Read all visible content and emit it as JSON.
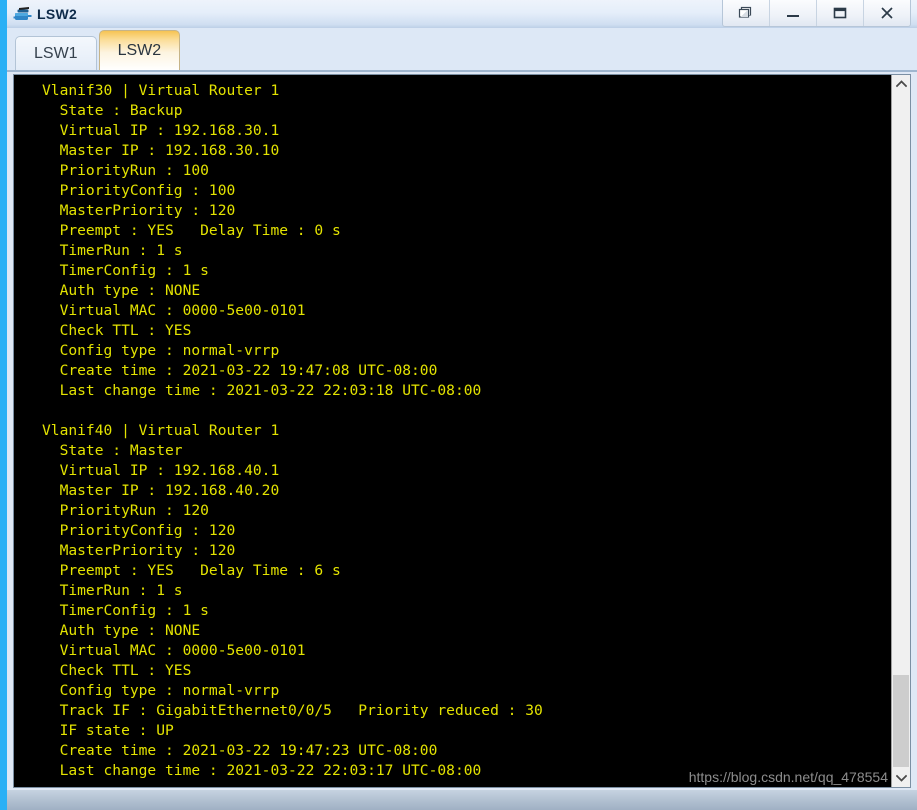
{
  "window": {
    "title": "LSW2",
    "icon": "switch-icon",
    "controls": [
      {
        "name": "restore-down-button",
        "glyph": "restore"
      },
      {
        "name": "minimize-button",
        "glyph": "minimize"
      },
      {
        "name": "maximize-button",
        "glyph": "maximize"
      },
      {
        "name": "close-button",
        "glyph": "close"
      }
    ],
    "frame_color": "#2ab0f5"
  },
  "tabs": [
    {
      "label": "LSW1",
      "active": false
    },
    {
      "label": "LSW2",
      "active": true
    }
  ],
  "terminal": {
    "background": "#000000",
    "foreground": "#e3e300",
    "content": "Vlanif30 | Virtual Router 1\n  State : Backup\n  Virtual IP : 192.168.30.1\n  Master IP : 192.168.30.10\n  PriorityRun : 100\n  PriorityConfig : 100\n  MasterPriority : 120\n  Preempt : YES   Delay Time : 0 s\n  TimerRun : 1 s\n  TimerConfig : 1 s\n  Auth type : NONE\n  Virtual MAC : 0000-5e00-0101\n  Check TTL : YES\n  Config type : normal-vrrp\n  Create time : 2021-03-22 19:47:08 UTC-08:00\n  Last change time : 2021-03-22 22:03:18 UTC-08:00\n\nVlanif40 | Virtual Router 1\n  State : Master\n  Virtual IP : 192.168.40.1\n  Master IP : 192.168.40.20\n  PriorityRun : 120\n  PriorityConfig : 120\n  MasterPriority : 120\n  Preempt : YES   Delay Time : 6 s\n  TimerRun : 1 s\n  TimerConfig : 1 s\n  Auth type : NONE\n  Virtual MAC : 0000-5e00-0101\n  Check TTL : YES\n  Config type : normal-vrrp\n  Track IF : GigabitEthernet0/0/5   Priority reduced : 30\n  IF state : UP\n  Create time : 2021-03-22 19:47:23 UTC-08:00\n  Last change time : 2021-03-22 22:03:17 UTC-08:00"
  },
  "scrollbar": {
    "up_arrow": "chevron-up-icon",
    "down_arrow": "chevron-down-icon"
  },
  "watermark": {
    "text": "https://blog.csdn.net/qq_478554"
  }
}
